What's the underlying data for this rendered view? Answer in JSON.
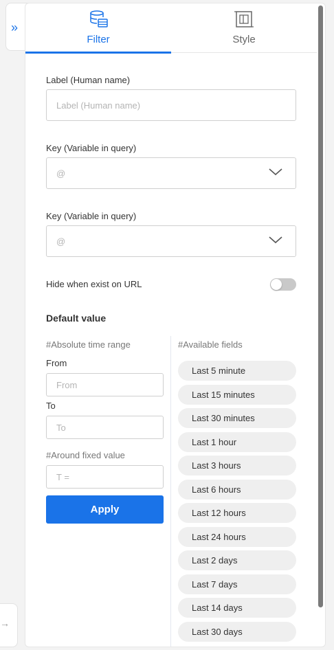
{
  "tabs": [
    {
      "label": "Filter",
      "icon": "database-icon",
      "active": true
    },
    {
      "label": "Style",
      "icon": "layout-icon",
      "active": false
    }
  ],
  "form": {
    "label_title": "Label (Human name)",
    "label_placeholder": "Label (Human name)",
    "key1_title": "Key (Variable in query)",
    "key1_value": "@",
    "key2_title": "Key (Variable in query)",
    "key2_value": "@",
    "hide_label": "Hide when exist on URL",
    "hide_toggle_on": false,
    "default_value_title": "Default value"
  },
  "time_range": {
    "title": "#Absolute time range",
    "from_label": "From",
    "from_placeholder": "From",
    "to_label": "To",
    "to_placeholder": "To",
    "fixed_title": "#Around fixed value",
    "fixed_placeholder": "T =",
    "apply_label": "Apply"
  },
  "available_fields": {
    "title": "#Available fields",
    "items": [
      "Last 5 minute",
      "Last 15 minutes",
      "Last 30 minutes",
      "Last 1 hour",
      "Last 3 hours",
      "Last 6 hours",
      "Last 12 hours",
      "Last 24 hours",
      "Last 2 days",
      "Last 7 days",
      "Last 14 days",
      "Last 30 days"
    ]
  },
  "colors": {
    "accent": "#1a73e8",
    "chip_bg": "#efefef",
    "toggle_off": "#c9c9c9"
  }
}
